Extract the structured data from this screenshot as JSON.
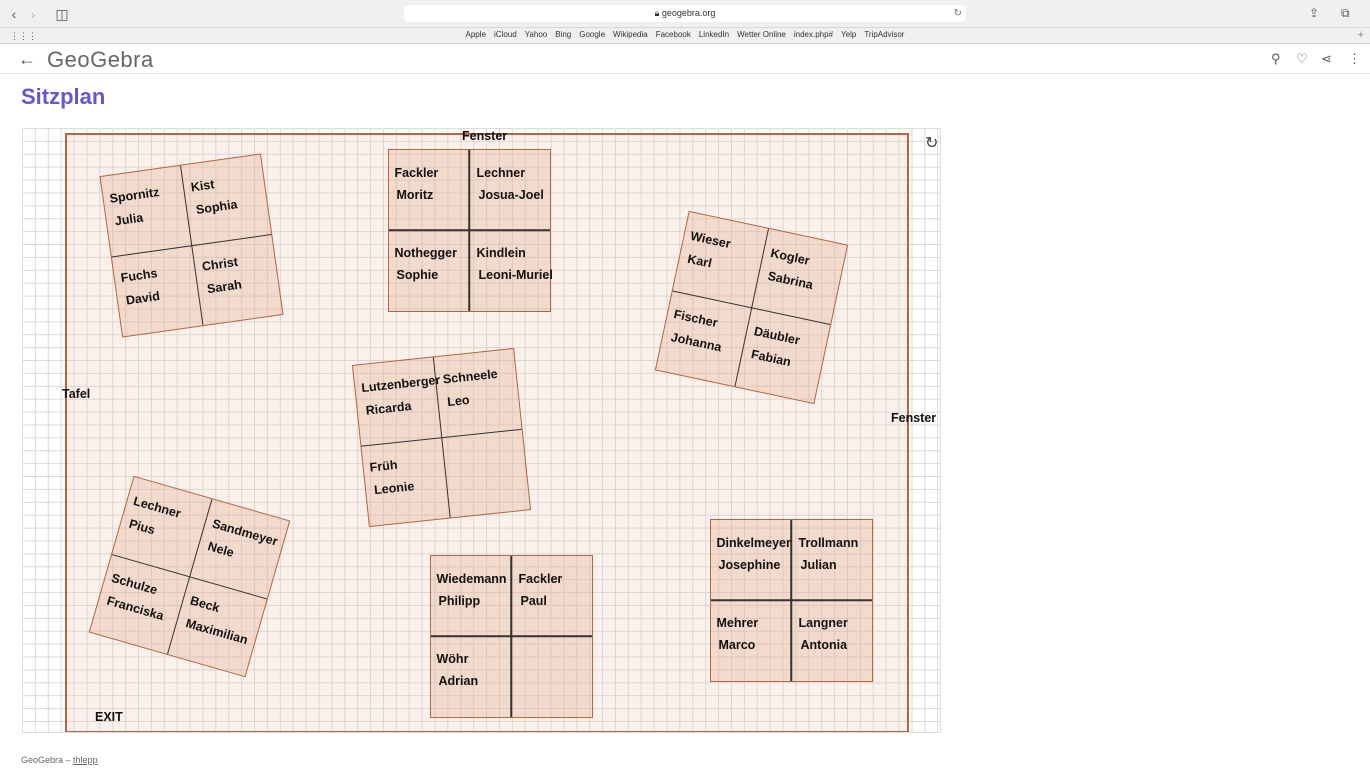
{
  "browser": {
    "url": "geogebra.org",
    "bookmarks": [
      "Apple",
      "iCloud",
      "Yahoo",
      "Bing",
      "Google",
      "Wikipedia",
      "Facebook",
      "LinkedIn",
      "Wetter Online",
      "index.php#",
      "Yelp",
      "TripAdvisor"
    ]
  },
  "header": {
    "logo": "GeoGebra"
  },
  "page": {
    "title": "Sitzplan"
  },
  "room": {
    "labels": {
      "window_top": "Fenster",
      "window_right": "Fenster",
      "board": "Tafel",
      "exit": "EXIT"
    }
  },
  "desks": [
    {
      "seats": [
        [
          "Spornitz",
          "Julia"
        ],
        [
          "Kist",
          "Sophia"
        ],
        [
          "Fuchs",
          "David"
        ],
        [
          "Christ",
          "Sarah"
        ]
      ]
    },
    {
      "seats": [
        [
          "Fackler",
          "Moritz"
        ],
        [
          "Lechner",
          "Josua-Joel"
        ],
        [
          "Nothegger",
          "Sophie"
        ],
        [
          "Kindlein",
          "Leoni-Muriel"
        ]
      ]
    },
    {
      "seats": [
        [
          "Wieser",
          "Karl"
        ],
        [
          "Kogler",
          "Sabrina"
        ],
        [
          "Fischer",
          "Johanna"
        ],
        [
          "Däubler",
          "Fabian"
        ]
      ]
    },
    {
      "seats": [
        [
          "Lutzenberger",
          "Ricarda"
        ],
        [
          "Schneele",
          "Leo"
        ],
        [
          "Früh",
          "Leonie"
        ],
        [
          "",
          ""
        ]
      ]
    },
    {
      "seats": [
        [
          "Lechner",
          "Pius"
        ],
        [
          "Sandmeyer",
          "Nele"
        ],
        [
          "Schulze",
          "Franciska"
        ],
        [
          "Beck",
          "Maximilian"
        ]
      ]
    },
    {
      "seats": [
        [
          "Wiedemann",
          "Philipp"
        ],
        [
          "Fackler",
          "Paul"
        ],
        [
          "Wöhr",
          "Adrian"
        ],
        [
          "",
          ""
        ]
      ]
    },
    {
      "seats": [
        [
          "Dinkelmeyer",
          "Josephine"
        ],
        [
          "Trollmann",
          "Julian"
        ],
        [
          "Mehrer",
          "Marco"
        ],
        [
          "Langner",
          "Antonia"
        ]
      ]
    }
  ],
  "footer": {
    "brand": "GeoGebra",
    "separator": " – ",
    "author": "thlepp"
  }
}
